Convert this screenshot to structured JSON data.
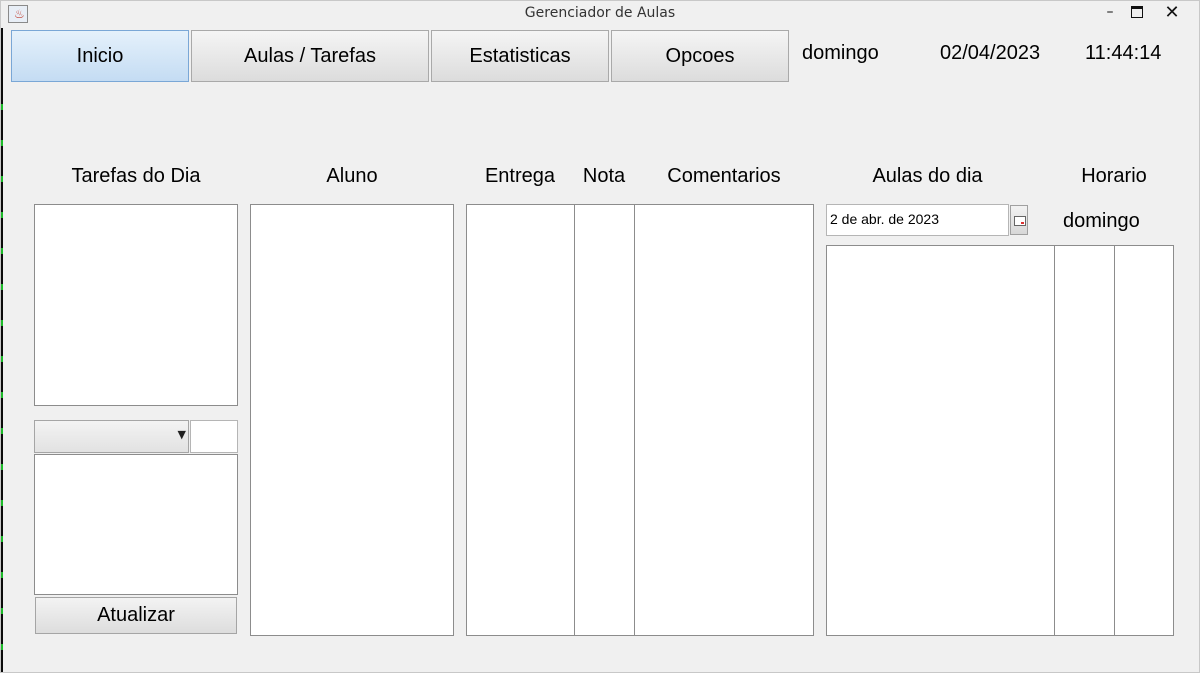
{
  "window": {
    "title": "Gerenciador de Aulas",
    "minimize": "–",
    "close": "✕"
  },
  "tabs": [
    {
      "label": "Inicio",
      "active": true
    },
    {
      "label": "Aulas / Tarefas",
      "active": false
    },
    {
      "label": "Estatisticas",
      "active": false
    },
    {
      "label": "Opcoes",
      "active": false
    }
  ],
  "status": {
    "weekday": "domingo",
    "date": "02/04/2023",
    "time": "11:44:14"
  },
  "tasks_panel": {
    "title": "Tarefas do Dia",
    "update_button": "Atualizar"
  },
  "students_table": {
    "columns": [
      "Aluno",
      "Entrega",
      "Nota",
      "Comentarios"
    ]
  },
  "classes_panel": {
    "title": "Aulas do dia",
    "schedule_header": "Horario",
    "date_value": "2 de abr. de 2023",
    "weekday": "domingo"
  },
  "icons": [
    "java-app-icon",
    "chevron-down-icon",
    "calendar-icon"
  ]
}
